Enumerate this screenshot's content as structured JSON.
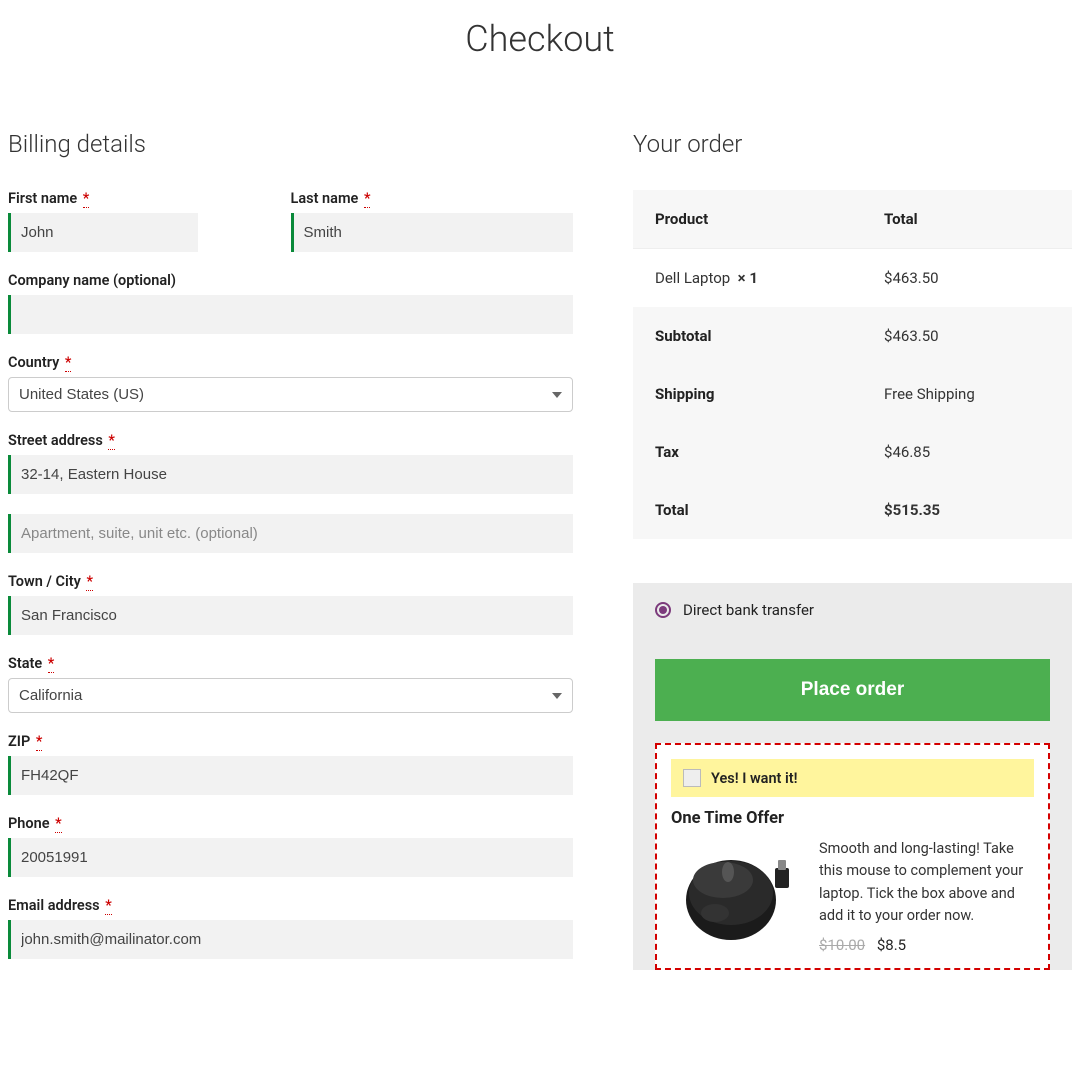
{
  "page": {
    "title": "Checkout"
  },
  "billing": {
    "heading": "Billing details",
    "first_name": {
      "label": "First name",
      "value": "John"
    },
    "last_name": {
      "label": "Last name",
      "value": "Smith"
    },
    "company": {
      "label": "Company name (optional)",
      "value": ""
    },
    "country": {
      "label": "Country",
      "value": "United States (US)"
    },
    "address1": {
      "label": "Street address",
      "value": "32-14, Eastern House"
    },
    "address2": {
      "placeholder": "Apartment, suite, unit etc. (optional)",
      "value": ""
    },
    "city": {
      "label": "Town / City",
      "value": "San Francisco"
    },
    "state": {
      "label": "State",
      "value": "California"
    },
    "zip": {
      "label": "ZIP",
      "value": "FH42QF"
    },
    "phone": {
      "label": "Phone",
      "value": "20051991"
    },
    "email": {
      "label": "Email address",
      "value": "john.smith@mailinator.com"
    }
  },
  "order": {
    "heading": "Your order",
    "columns": {
      "product": "Product",
      "total": "Total"
    },
    "items": [
      {
        "name": "Dell Laptop",
        "qty_label": "× 1",
        "total": "$463.50"
      }
    ],
    "subtotal": {
      "label": "Subtotal",
      "value": "$463.50"
    },
    "shipping": {
      "label": "Shipping",
      "value": "Free Shipping"
    },
    "tax": {
      "label": "Tax",
      "value": "$46.85"
    },
    "total": {
      "label": "Total",
      "value": "$515.35"
    }
  },
  "payment": {
    "method": "Direct bank transfer",
    "place_order": "Place order"
  },
  "offer": {
    "checkbox_label": "Yes! I want it!",
    "title": "One Time Offer",
    "description": "Smooth and long-lasting! Take this mouse to complement your laptop. Tick the box above and add it to your order now.",
    "old_price": "$10.00",
    "new_price": "$8.5"
  },
  "required_mark": "*"
}
